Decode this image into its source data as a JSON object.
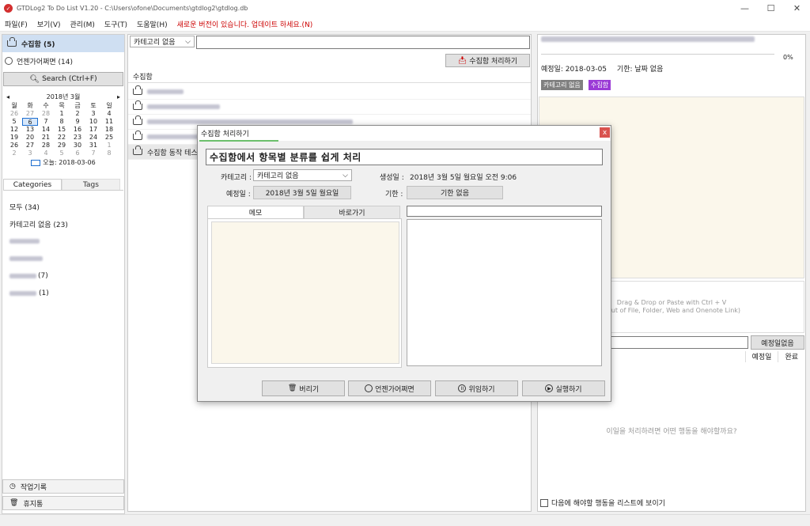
{
  "window": {
    "title": "GTDLog2 To Do List V1.20 - C:\\Users\\ofone\\Documents\\gtdlog2\\gtdlog.db",
    "min": "—",
    "max": "☐",
    "close": "✕"
  },
  "menu": {
    "items": [
      "파일(F)",
      "보기(V)",
      "관리(M)",
      "도구(T)",
      "도움말(H)"
    ],
    "update_notice": "새로운 버전이 있습니다. 업데이트 하세요.(N)"
  },
  "left": {
    "inbox_label": "수집함 (5)",
    "someday_label": "언젠가어쩌면 (14)",
    "search_label": "Search (Ctrl+F)",
    "calendar": {
      "month_label": "2018년 3월",
      "prev": "◂",
      "next": "▸",
      "dow": [
        "월",
        "화",
        "수",
        "목",
        "금",
        "토",
        "일"
      ],
      "days": [
        "26",
        "27",
        "28",
        "1",
        "2",
        "3",
        "4",
        "5",
        "6",
        "7",
        "8",
        "9",
        "10",
        "11",
        "12",
        "13",
        "14",
        "15",
        "16",
        "17",
        "18",
        "19",
        "20",
        "21",
        "22",
        "23",
        "24",
        "25",
        "26",
        "27",
        "28",
        "29",
        "30",
        "31",
        "1",
        "2",
        "3",
        "4",
        "5",
        "6",
        "7",
        "8"
      ],
      "today_label": "오늘: 2018-03-06"
    },
    "tabs": {
      "categories": "Categories",
      "tags": "Tags"
    },
    "categories": [
      {
        "label": "모두 (34)"
      },
      {
        "label": "카테고리 없음 (23)"
      },
      {
        "label": ""
      },
      {
        "label": ""
      },
      {
        "label": "(7)"
      },
      {
        "label": "(1)"
      }
    ],
    "worklog_label": "작업기록",
    "trash_label": "휴지통"
  },
  "middle": {
    "category_filter": "카테고리 없음",
    "process_button": "수집함 처리하기",
    "list_header": "수집함",
    "rows": [
      {
        "label": ""
      },
      {
        "label": ""
      },
      {
        "label": ""
      },
      {
        "label": ""
      },
      {
        "label": "수집함 동작 테스"
      }
    ]
  },
  "right": {
    "progress": "0%",
    "progress_value": 0,
    "planned_date": "예정일: 2018-03-05",
    "deadline": "기한: 날짜 없음",
    "tag_category": "카테고리 없음",
    "tag_inbox": "수집함",
    "drop_hint_line1": "Drag & Drop or Paste with Ctrl + V",
    "drop_hint_line2": "rtcut of File, Folder, Web and Onenote Link)",
    "no_date_button": "예정일없음",
    "col_planned": "예정일",
    "col_done": "완료",
    "action_prompt": "이일을 처리하려면 어떤 행동을 해야할까요?",
    "show_next_actions": "다음에 해야할 행동을 리스트에 보이기"
  },
  "dialog": {
    "title": "수집함 처리하기",
    "close": "x",
    "subject": "수집함에서 항목별 분류를 쉽게 처리",
    "category_label": "카테고리 :",
    "category_value": "카테고리 없음",
    "created_label": "생성일 :",
    "created_value": "2018년 3월 5일 월요일 오전 9:06",
    "planned_label": "예정일 :",
    "planned_value": "2018년 3월 5일 월요일",
    "deadline_label": "기한 :",
    "deadline_value": "기한 없음",
    "tab_memo": "메모",
    "tab_shortcut": "바로가기",
    "btn_discard": "버리기",
    "btn_someday": "언젠가어쩌면",
    "btn_delegate": "위임하기",
    "btn_execute": "실행하기"
  },
  "colors": {
    "accent": "#1e6fd0",
    "inbox_highlight": "#cfdff2",
    "purple_tag": "#9b3bd6",
    "memo_bg": "#fbf7eb",
    "warn": "#cc0000"
  }
}
